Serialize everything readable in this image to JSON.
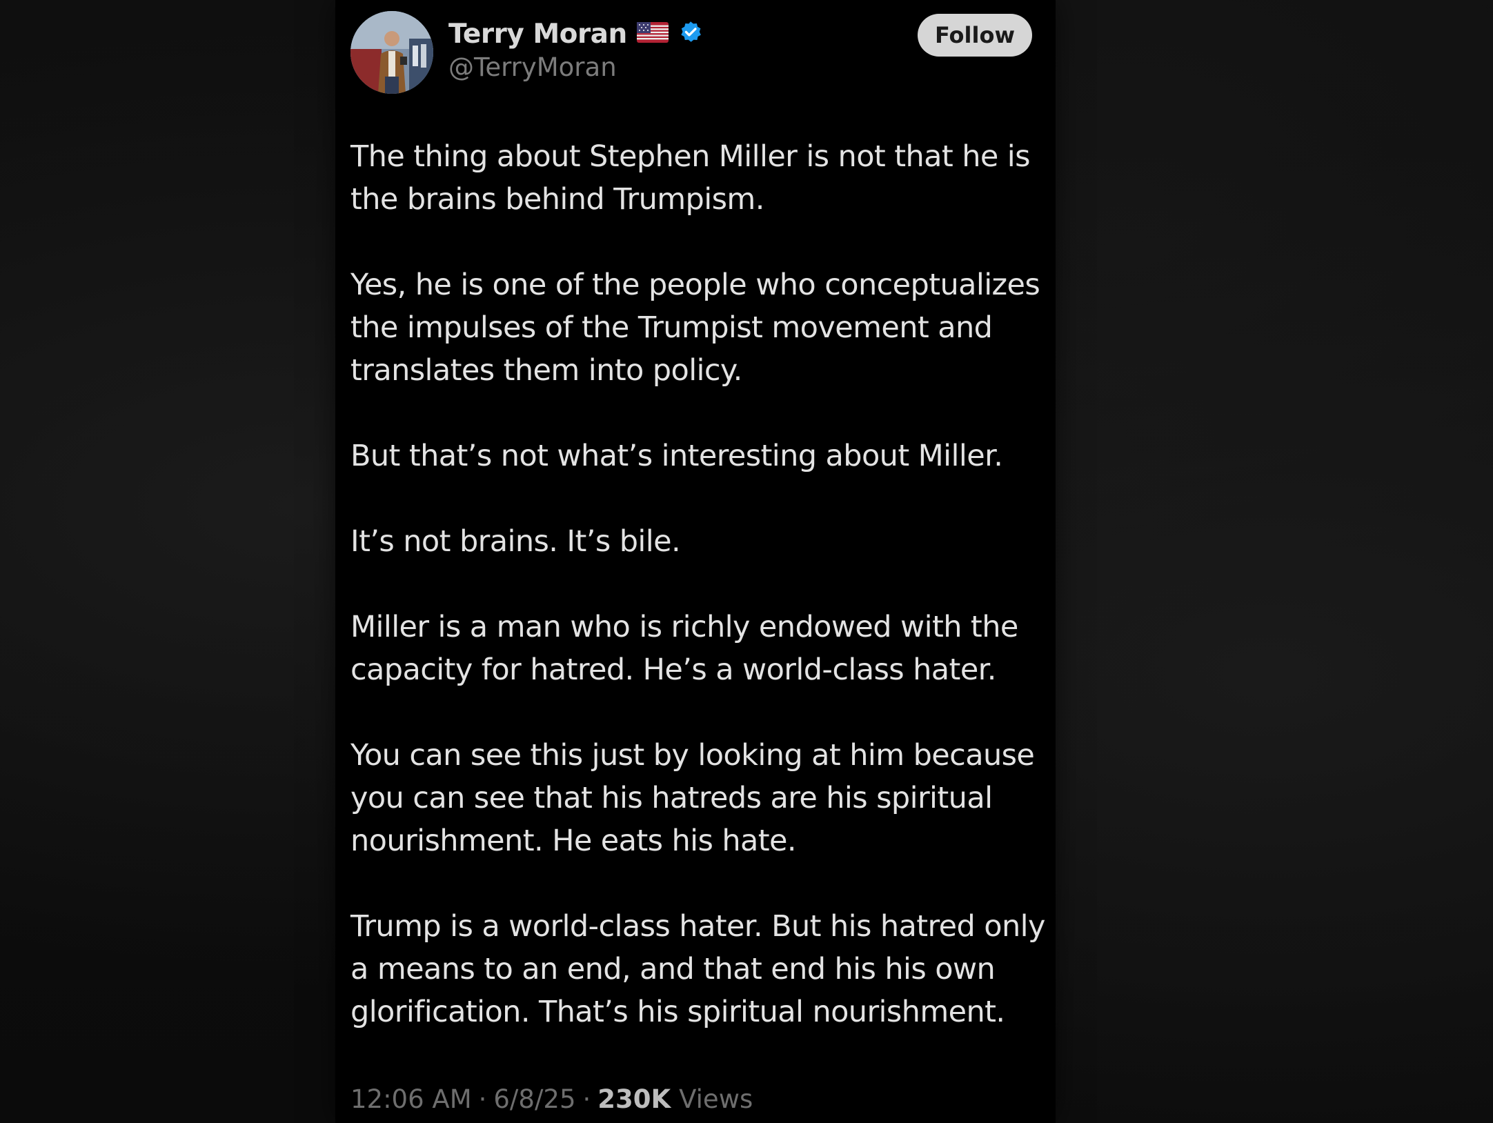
{
  "author": {
    "display_name": "Terry Moran",
    "flag_icon": "us-flag-icon",
    "verified_icon": "verified-badge-icon",
    "verified_color": "#1d9bf0",
    "handle": "@TerryMoran"
  },
  "follow_button": {
    "label": "Follow"
  },
  "post": {
    "paragraphs": [
      "The thing about Stephen Miller is not that he is\nthe brains behind Trumpism.",
      "Yes, he is one of the people who conceptualizes\nthe impulses of the Trumpist movement and\ntranslates them into policy.",
      "But that’s not what’s interesting about Miller.",
      "It’s not brains. It’s bile.",
      "Miller is a man who is richly endowed with the\ncapacity for hatred. He’s a world-class hater.",
      "You can see this just by looking at him because\nyou can see that his hatreds are his spiritual\nnourishment. He eats his hate.",
      "Trump is a world-class hater. But his hatred only\na means to an end, and that end his his own\nglorification. That’s his spiritual nourishment."
    ]
  },
  "meta": {
    "time": "12:06 AM",
    "separator": "·",
    "date": "6/8/25",
    "views_count": "230K",
    "views_label": "Views"
  }
}
